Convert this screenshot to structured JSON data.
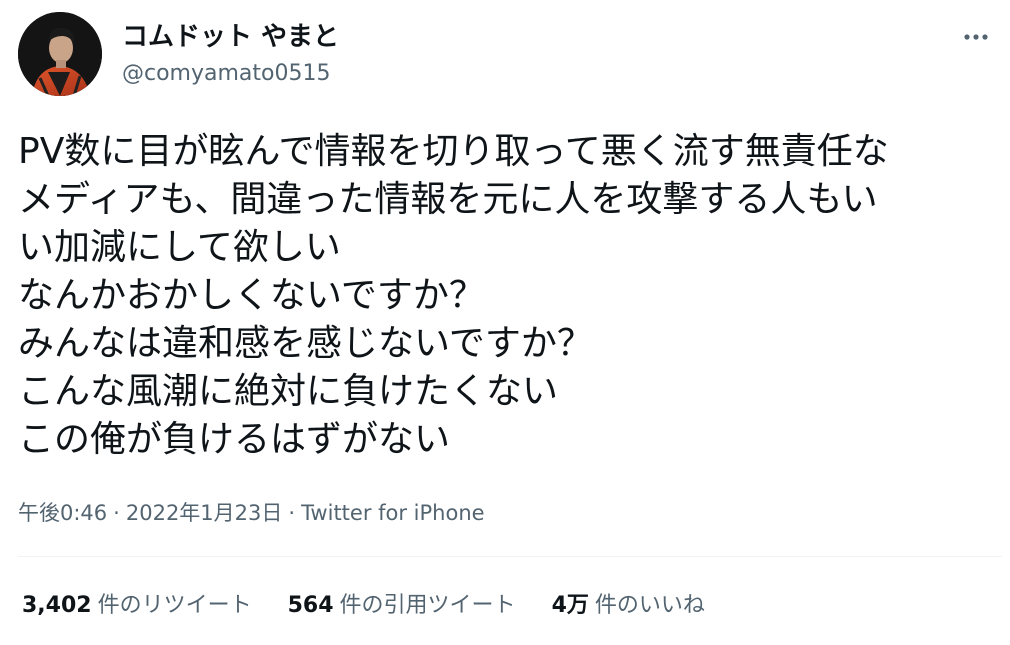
{
  "author": {
    "display_name": "コムドット やまと",
    "handle": "@comyamato0515",
    "avatar_icon": "profile-photo"
  },
  "tweet": {
    "lines": [
      "PV数に目が眩んで情報を切り取って悪く流す無責任な",
      "メディアも、間違った情報を元に人を攻撃する人もい",
      "い加減にして欲しい",
      "なんかおかしくないですか？",
      "みんなは違和感を感じないですか？",
      "こんな風潮に絶対に負けたくない",
      "この俺が負けるはずがない"
    ]
  },
  "meta": {
    "time": "午後0:46",
    "separator": "·",
    "date": "2022年1月23日",
    "source": "Twitter for iPhone"
  },
  "stats": {
    "retweets_count": "3,402",
    "retweets_label": "件のリツイート",
    "quotes_count": "564",
    "quotes_label": "件の引用ツイート",
    "likes_count": "4万",
    "likes_label": "件のいいね"
  },
  "icons": {
    "more": "more-horizontal-icon"
  },
  "colors": {
    "text_primary": "#0f1419",
    "text_secondary": "#536471",
    "divider": "#eff3f4",
    "background": "#ffffff"
  }
}
